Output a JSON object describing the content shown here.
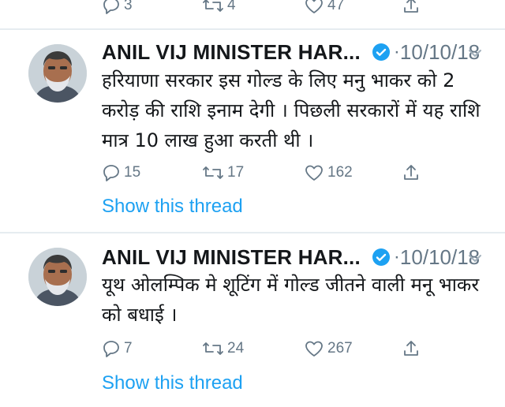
{
  "top_actions": {
    "replies": "3",
    "retweets": "4",
    "likes": "47"
  },
  "tweets": [
    {
      "name": "ANIL VIJ MINISTER HAR...",
      "date": "10/10/18",
      "text": "हरियाणा सरकार इस गोल्ड के लिए मनु भाकर को 2 करोड़ की राशि इनाम देगी । पिछली सरकारों में यह राशि मात्र 10 लाख हुआ करती थी ।",
      "replies": "15",
      "retweets": "17",
      "likes": "162",
      "show_thread": "Show this thread"
    },
    {
      "name": "ANIL VIJ MINISTER HAR...",
      "date": "10/10/18",
      "text": "यूथ ओलम्पिक मे शूटिंग में गोल्ड जीतने वाली मनू भाकर को बधाई ।",
      "replies": "7",
      "retweets": "24",
      "likes": "267",
      "show_thread": "Show this thread"
    }
  ],
  "icons": {
    "reply": "reply-icon",
    "retweet": "retweet-icon",
    "like": "heart-icon",
    "share": "share-icon",
    "verified": "verified-badge-icon",
    "menu": "chevron-down-icon"
  },
  "colors": {
    "link": "#1da1f2",
    "muted": "#657786",
    "verified": "#1da1f2",
    "divider": "#e6ecf0"
  }
}
